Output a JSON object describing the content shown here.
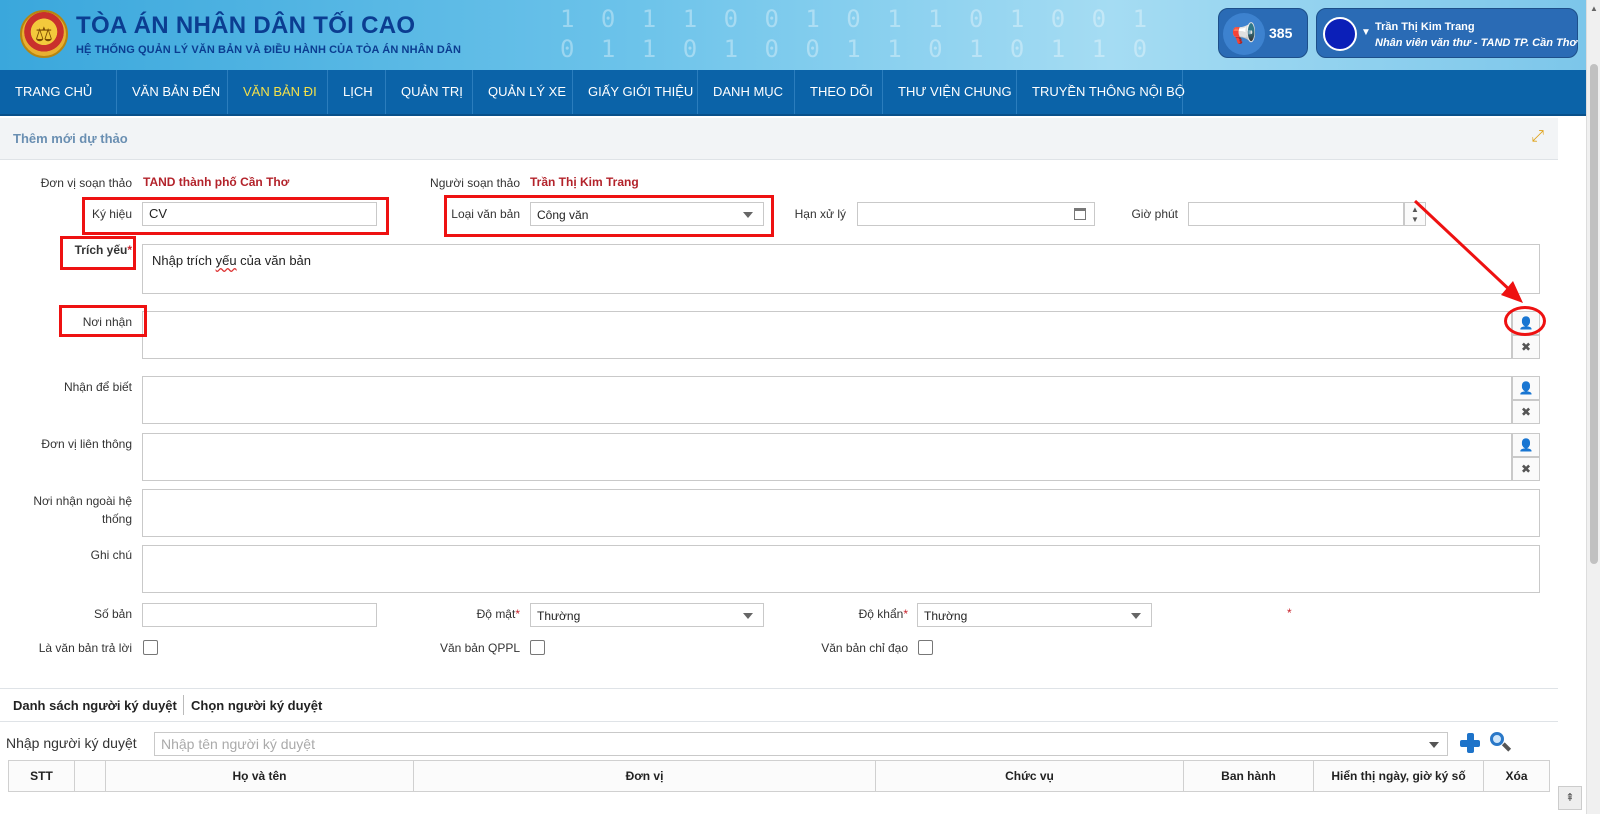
{
  "header": {
    "title": "TÒA ÁN NHÂN DÂN TỐI CAO",
    "subtitle": "HỆ THỐNG QUẢN LÝ VĂN BẢN VÀ ĐIỀU HÀNH CỦA TÒA ÁN NHÂN DÂN",
    "notification_count": "385",
    "user_name": "Trần Thị Kim Trang",
    "user_role": "Nhân viên văn thư - TAND TP. Cần Thơ"
  },
  "nav": {
    "items": [
      "TRANG CHỦ",
      "VĂN BẢN ĐẾN",
      "VĂN BẢN ĐI",
      "LỊCH",
      "QUẢN TRỊ",
      "QUẢN LÝ XE",
      "GIẤY GIỚI THIỆU",
      "DANH MỤC",
      "THEO DÕI",
      "THƯ VIỆN CHUNG",
      "TRUYỀN THÔNG NỘI BỘ"
    ],
    "active": "VĂN BẢN ĐI"
  },
  "panel": {
    "title": "Thêm mới dự thảo"
  },
  "form": {
    "don_vi_label": "Đơn vị soạn thảo",
    "don_vi_value": "TAND thành phố Cần Thơ",
    "nguoi_label": "Người soạn thảo",
    "nguoi_value": "Trần Thị Kim Trang",
    "ky_hieu_label": "Ký hiệu",
    "ky_hieu_value": "CV",
    "loai_label": "Loại văn bản",
    "loai_value": "Công văn",
    "han_label": "Hạn xử lý",
    "han_value": "",
    "gio_label": "Giờ phút",
    "gio_value": "",
    "trich_yeu_label": "Trích yếu",
    "trich_yeu_pre": "Nhập trích ",
    "trich_yeu_word": "yếu",
    "trich_yeu_post": " của văn bản",
    "noi_nhan_label": "Nơi nhận",
    "nhan_de_biet_label": "Nhận để biết",
    "don_vi_lien_thong_label": "Đơn vị liên thông",
    "noi_nhan_ngoai_label": "Nơi nhận ngoài hệ thống",
    "ghi_chu_label": "Ghi chú",
    "so_ban_label": "Số bản",
    "so_ban_value": "",
    "do_mat_label": "Độ mật",
    "do_mat_value": "Thường",
    "do_khan_label": "Độ khẩn",
    "do_khan_value": "Thường",
    "tra_loi_label": "Là văn bản trả lời",
    "qppl_label": "Văn bản QPPL",
    "chi_dao_label": "Văn bản chỉ đạo",
    "required_mark": "*"
  },
  "signers": {
    "tab_list": "Danh sách người ký duyệt",
    "tab_choose": "Chọn người ký duyệt",
    "input_label": "Nhập người ký duyệt",
    "input_placeholder": "Nhập tên người ký duyệt",
    "columns": [
      "STT",
      "",
      "Họ và tên",
      "Đơn vị",
      "Chức vụ",
      "Ban hành",
      "Hiển thị ngày, giờ ký số",
      "Xóa"
    ]
  },
  "colors": {
    "accent": "#0b63a8",
    "annotation": "#ee1111",
    "active_nav": "#f5e14a",
    "required": "#c8232c"
  }
}
